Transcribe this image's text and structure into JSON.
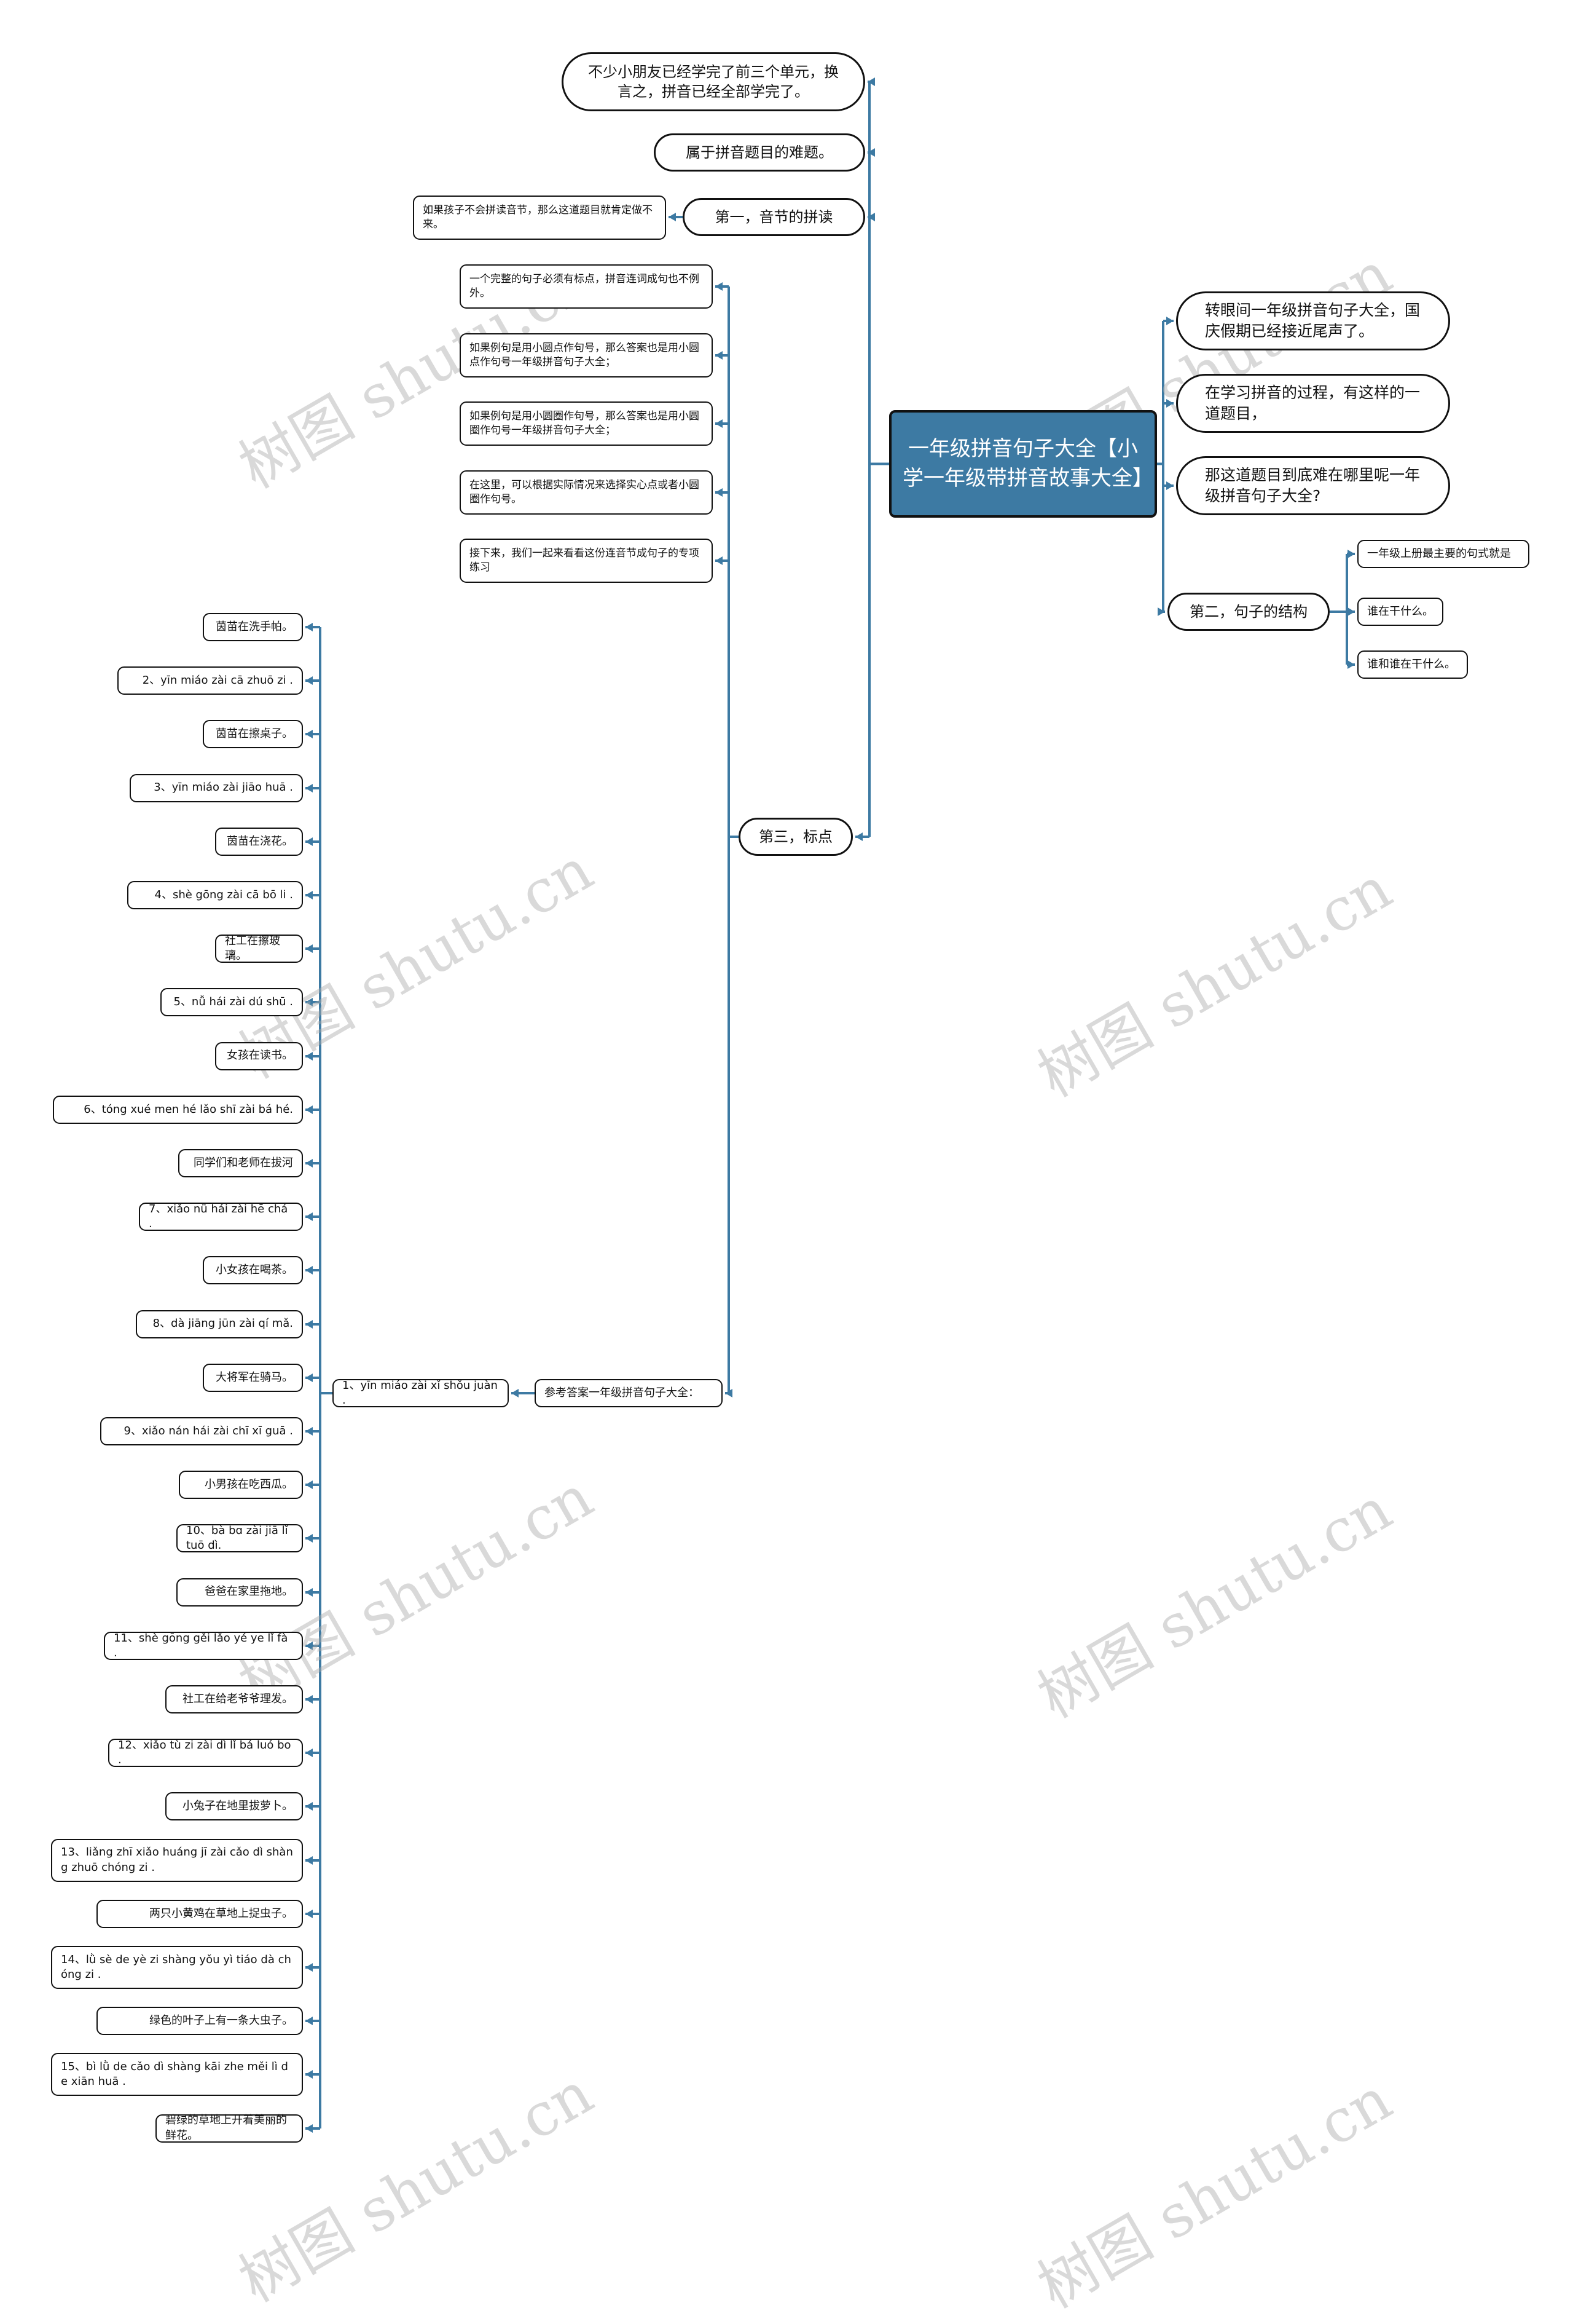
{
  "center": {
    "title": "一年级拼音句子大全【小学一年级带拼音故事大全】"
  },
  "colors": {
    "connector": "#3d7aa3",
    "center_fill": "#3d7aa3",
    "border": "#111111"
  },
  "watermark": "树图 shutu.cn",
  "left_branches": {
    "top1": "不少小朋友已经学完了前三个单元，换言之，拼音已经全部学完了。",
    "top2": "属于拼音题目的难题。",
    "first": {
      "label": "第一，音节的拼读",
      "child": "如果孩子不会拼读音节，那么这道题目就肯定做不来。"
    },
    "third": {
      "label": "第三，标点",
      "children": [
        "一个完整的句子必须有标点，拼音连词成句也不例外。",
        "如果例句是用小圆点作句号，那么答案也是用小圆点作句号一年级拼音句子大全；",
        "如果例句是用小圆圈作句号，那么答案也是用小圆圈作句号一年级拼音句子大全；",
        "在这里，可以根据实际情况来选择实心点或者小圆圈作句号。",
        "接下来，我们一起来看看这份连音节成句子的专项练习"
      ],
      "answers": {
        "label": "参考答案一年级拼音句子大全：",
        "first": "1、yīn miáo zài xǐ shǒu juàn .",
        "items": [
          "茵苗在洗手帕。",
          "2、yīn miáo zài cā zhuō zi .",
          "茵苗在擦桌子。",
          "3、yīn miáo zài jiāo huā .",
          "茵苗在浇花。",
          "4、shè gōng zài cā bō li .",
          "社工在擦玻璃。",
          "5、nǚ hái zài dú shū .",
          "女孩在读书。",
          "6、tóng xué men hé lǎo shī zài bá hé.",
          "同学们和老师在拔河",
          "7、xiǎo nǚ hái zài hē chá .",
          "小女孩在喝茶。",
          "8、dà jiāng jūn zài qí mǎ.",
          "大将军在骑马。",
          "9、xiǎo nán hái zài chī xī guā .",
          "小男孩在吃西瓜。",
          "10、bà bɑ zài jiā lǐ tuō dì.",
          "爸爸在家里拖地。",
          "11、shè gōng gěi lǎo yé ye lǐ fà .",
          "社工在给老爷爷理发。",
          "12、xiǎo tù zi zài dì lǐ bá luó bo .",
          "小兔子在地里拔萝卜。",
          "13、liǎng zhī xiǎo huáng jī zài cǎo dì shàng zhuō chóng zi .",
          "两只小黄鸡在草地上捉虫子。",
          "14、lǜ sè de yè zi shàng yǒu yì tiáo dà chóng zi .",
          "绿色的叶子上有一条大虫子。",
          "15、bì lǜ de cǎo dì shàng kāi zhe měi lì de xiān huā .",
          "碧绿的草地上开着美丽的鲜花。"
        ]
      }
    }
  },
  "right_branches": {
    "items": [
      "转眼间一年级拼音句子大全，国庆假期已经接近尾声了。",
      "在学习拼音的过程，有这样的一道题目，",
      "那这道题目到底难在哪里呢一年级拼音句子大全?"
    ],
    "second": {
      "label": "第二，句子的结构",
      "children": [
        "一年级上册最主要的句式就是",
        "谁在干什么。",
        "谁和谁在干什么。"
      ]
    }
  }
}
